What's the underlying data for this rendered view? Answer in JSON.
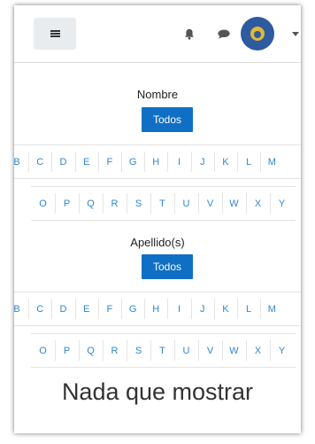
{
  "header": {
    "menu_icon": "hamburger-icon",
    "notification_icon": "bell-icon",
    "messages_icon": "chat-bubble-icon",
    "user_menu_icon": "chevron-down-icon"
  },
  "first_name_filter": {
    "label": "Nombre",
    "all_button": "Todos",
    "row1": [
      "B",
      "C",
      "D",
      "E",
      "F",
      "G",
      "H",
      "I",
      "J",
      "K",
      "L",
      "M"
    ],
    "row2": [
      "O",
      "P",
      "Q",
      "R",
      "S",
      "T",
      "U",
      "V",
      "W",
      "X",
      "Y"
    ]
  },
  "last_name_filter": {
    "label": "Apellido(s)",
    "all_button": "Todos",
    "row1": [
      "B",
      "C",
      "D",
      "E",
      "F",
      "G",
      "H",
      "I",
      "J",
      "K",
      "L",
      "M"
    ],
    "row2": [
      "O",
      "P",
      "Q",
      "R",
      "S",
      "T",
      "U",
      "V",
      "W",
      "X",
      "Y"
    ]
  },
  "empty_message": "Nada que mostrar",
  "colors": {
    "accent": "#0f6fc5",
    "letter_link": "#2f86cf",
    "avatar": "#2e5a9f"
  }
}
